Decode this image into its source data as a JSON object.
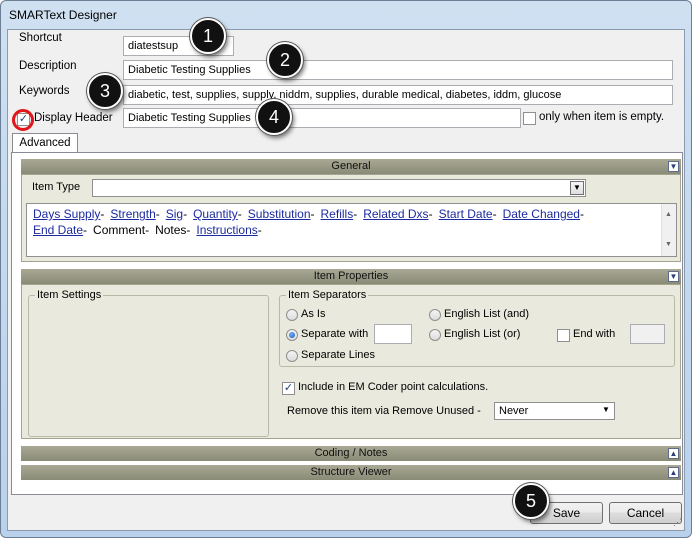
{
  "window": {
    "title": "SMARText Designer"
  },
  "fields": {
    "shortcut_label": "Shortcut",
    "shortcut_value": "diatestsup",
    "description_label": "Description",
    "description_value": "Diabetic Testing Supplies",
    "keywords_label": "Keywords",
    "keywords_value": "diabetic, test, supplies, supply, niddm, supplies, durable medical, diabetes, iddm, glucose",
    "display_header_label": "Display Header",
    "display_header_checked": true,
    "display_header_value": "Diabetic Testing Supplies",
    "only_when_empty_label": "only when item is empty."
  },
  "tabs": [
    {
      "label": "Advanced"
    }
  ],
  "sections": {
    "general": {
      "title": "General",
      "item_type_label": "Item Type",
      "item_type_value": "",
      "tokens_line1": [
        {
          "text": "Days Supply",
          "link": true
        },
        {
          "text": "Strength",
          "link": true
        },
        {
          "text": "Sig",
          "link": true
        },
        {
          "text": "Quantity",
          "link": true
        },
        {
          "text": "Substitution",
          "link": true
        },
        {
          "text": "Refills",
          "link": true
        },
        {
          "text": "Related Dxs",
          "link": true
        },
        {
          "text": "Start Date",
          "link": true
        },
        {
          "text": "Date Changed",
          "link": true
        }
      ],
      "tokens_line2": [
        {
          "text": "End Date",
          "link": true
        },
        {
          "text": "Comment",
          "link": false
        },
        {
          "text": "Notes",
          "link": false
        },
        {
          "text": "Instructions",
          "link": true
        }
      ],
      "separator": "-"
    },
    "item_properties": {
      "title": "Item Properties",
      "item_settings_label": "Item Settings",
      "item_separators_label": "Item Separators",
      "radio_as_is": "As Is",
      "radio_separate_with": "Separate with",
      "radio_separate_lines": "Separate Lines",
      "radio_english_and": "English List (and)",
      "radio_english_or": "English List (or)",
      "end_with_label": "End with",
      "selected_separator": "Separate with",
      "include_em_label": "Include in EM Coder point calculations.",
      "include_em_checked": true,
      "remove_unused_label": "Remove this item via Remove Unused -",
      "remove_unused_value": "Never"
    },
    "coding_notes": {
      "title": "Coding / Notes"
    },
    "structure_viewer": {
      "title": "Structure Viewer"
    }
  },
  "buttons": {
    "save": "Save",
    "cancel": "Cancel"
  },
  "callouts": [
    "1",
    "2",
    "3",
    "4",
    "5"
  ],
  "colors": {
    "callout_bg": "#111111",
    "highlight_ring": "#e0161c",
    "link": "#1c2aa0",
    "section_header": "#8a8b76"
  }
}
